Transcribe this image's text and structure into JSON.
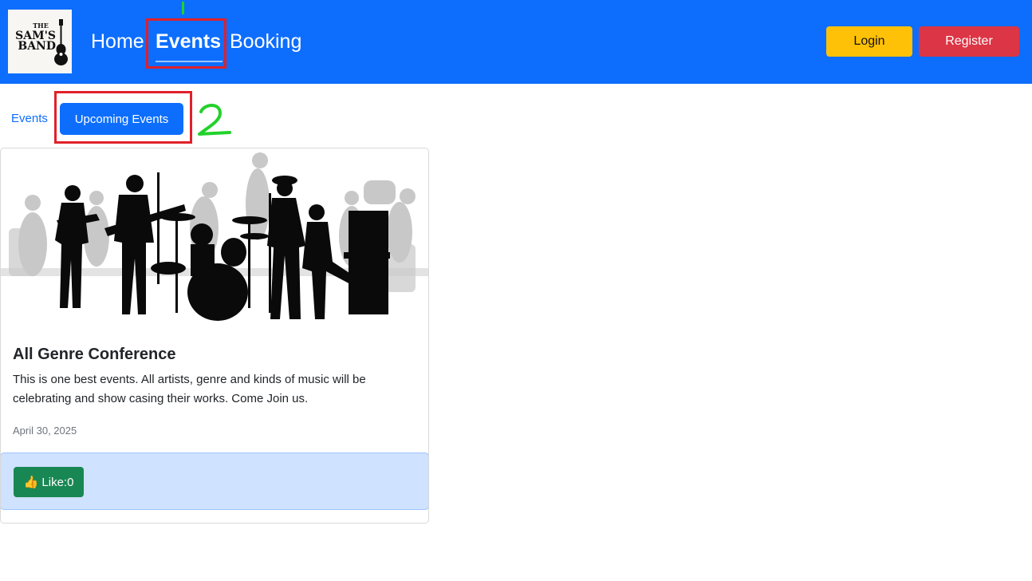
{
  "brand": {
    "line1": "THE",
    "line2": "SAM'S",
    "line3": "BAND"
  },
  "nav": {
    "home": "Home",
    "events": "Events",
    "booking": "Booking"
  },
  "auth": {
    "login": "Login",
    "register": "Register"
  },
  "subnav": {
    "events": "Events",
    "upcoming": "Upcoming Events"
  },
  "annotations": {
    "mark_1": "1",
    "mark_2": "2",
    "box_color": "#e0202a",
    "mark_color": "#22d22a"
  },
  "card": {
    "title": "All Genre Conference",
    "text": "This is one best events. All artists, genre and kinds of music will be celebrating and show casing their works. Come Join us.",
    "date": "April 30, 2025",
    "like_label": "👍 Like:0"
  },
  "colors": {
    "primary": "#0d6efd",
    "login": "#ffc107",
    "register": "#dc3545",
    "like": "#198754",
    "footer": "#cfe2ff"
  }
}
